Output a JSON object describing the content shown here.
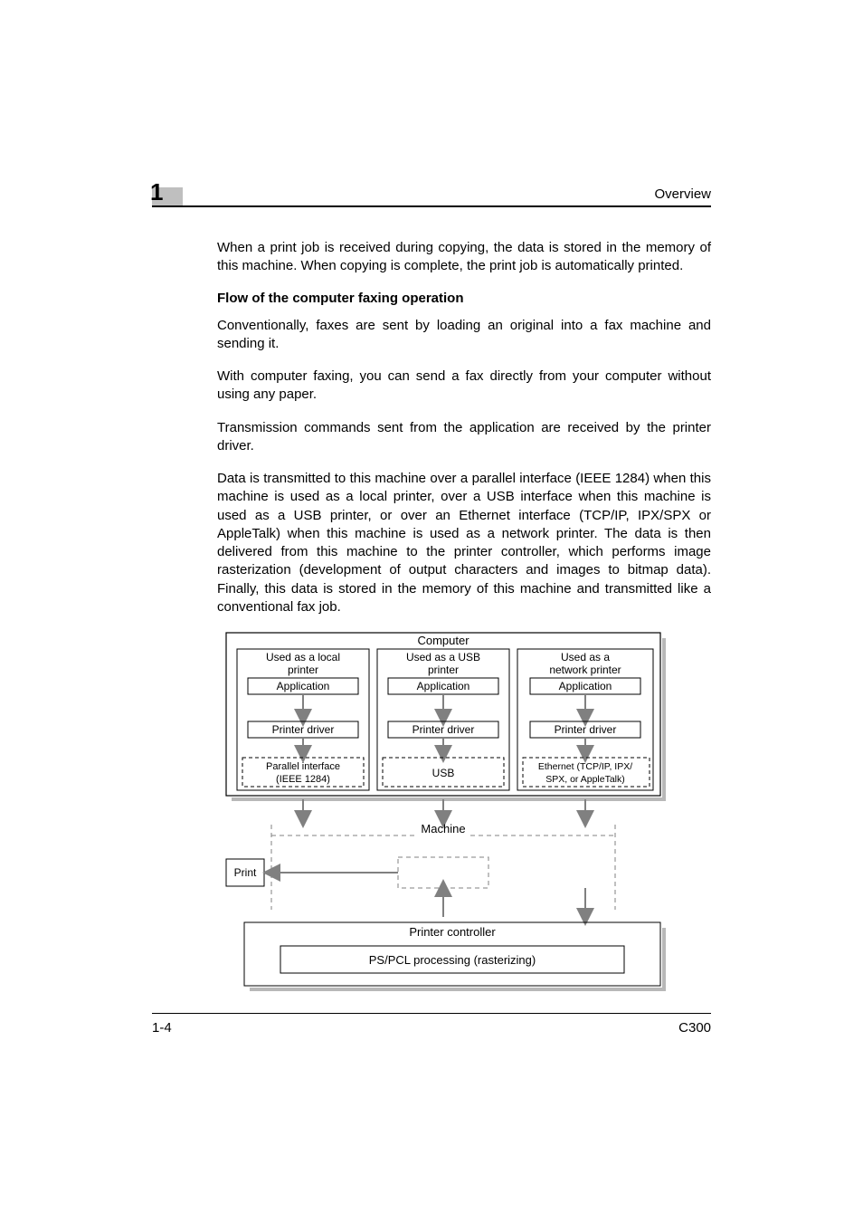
{
  "header": {
    "chapter_number": "1",
    "right_label": "Overview"
  },
  "body": {
    "intro_para": "When a print job is received during copying, the data is stored in the memory of this machine. When copying is complete, the print job is automatically printed.",
    "section_heading": "Flow of the computer faxing operation",
    "para2": "Conventionally, faxes are sent by loading an original into a fax machine and sending it.",
    "para3": "With computer faxing, you can send a fax directly from your computer without using any paper.",
    "para4": "Transmission commands sent from the application are received by the printer driver.",
    "para5": "Data is transmitted to this machine over a parallel interface (IEEE 1284) when this machine is used as a local printer, over a USB interface when this machine is used as a USB printer, or over an Ethernet interface (TCP/IP, IPX/SPX or AppleTalk) when this machine is used as a network printer. The data is then delivered from this machine to the printer controller, which performs image rasterization (development of output characters and images to bitmap data). Finally, this data is stored in the memory of this machine and transmitted like a conventional fax job."
  },
  "diagram": {
    "computer_label": "Computer",
    "col1": {
      "title_l1": "Used as a local",
      "title_l2": "printer",
      "app": "Application",
      "drv": "Printer driver",
      "iface_l1": "Parallel interface",
      "iface_l2": "(IEEE 1284)"
    },
    "col2": {
      "title_l1": "Used as a USB",
      "title_l2": "printer",
      "app": "Application",
      "drv": "Printer driver",
      "iface_l1": "USB"
    },
    "col3": {
      "title_l1": "Used as a",
      "title_l2": "network printer",
      "app": "Application",
      "drv": "Printer driver",
      "iface_l1": "Ethernet (TCP/IP, IPX/",
      "iface_l2": "SPX, or AppleTalk)"
    },
    "machine_label": "Machine",
    "print_label": "Print",
    "controller_label": "Printer controller",
    "processing_label": "PS/PCL processing (rasterizing)"
  },
  "footer": {
    "left": "1-4",
    "right": "C300"
  }
}
